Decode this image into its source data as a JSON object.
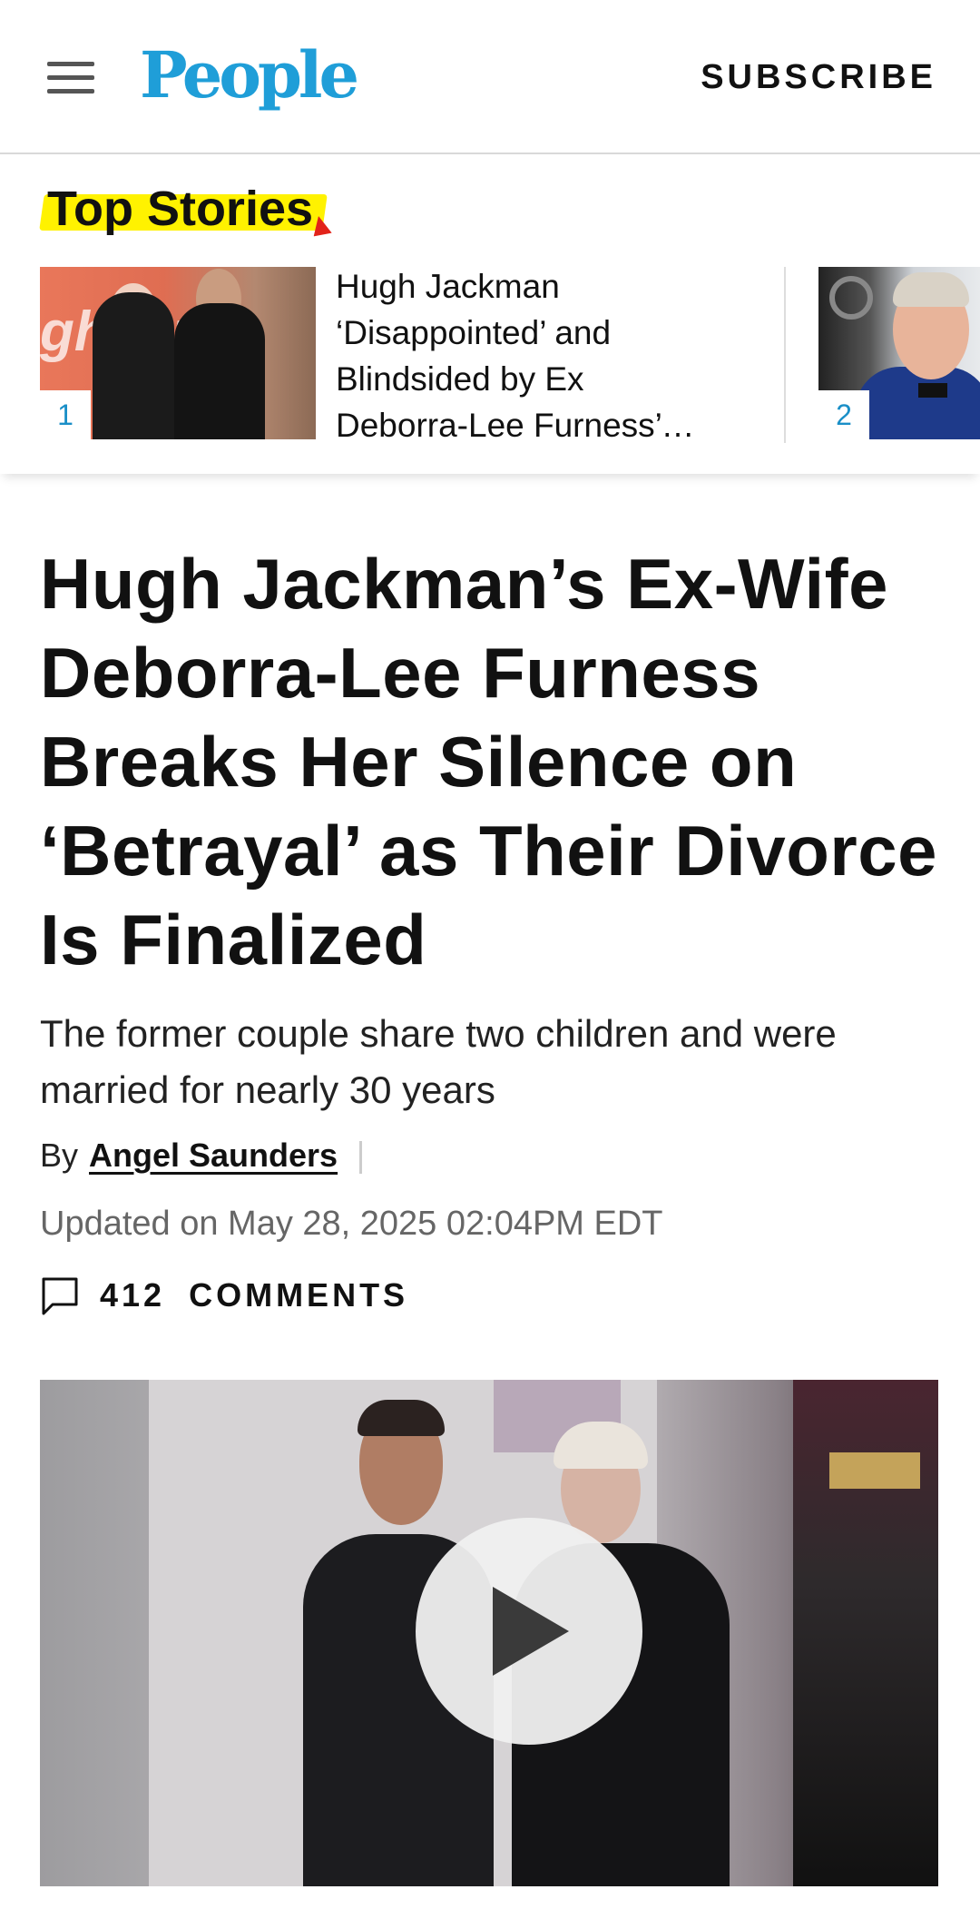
{
  "header": {
    "logo": "People",
    "subscribe_label": "SUBSCRIBE"
  },
  "top_stories": {
    "title": "Top Stories",
    "items": [
      {
        "rank": "1",
        "title": "Hugh Jackman ‘Disappointed’ and Blindsided by Ex Deborra-Lee Furness’ Comments",
        "thumb_text": "ghoste"
      },
      {
        "rank": "2",
        "title": ""
      }
    ]
  },
  "article": {
    "headline": "Hugh Jackman’s Ex-Wife Deborra-Lee Furness Breaks Her Silence on ‘Betrayal’ as Their Divorce Is Finalized",
    "dek": "The former couple share two children and were married for nearly 30 years",
    "byline_prefix": "By",
    "author": "Angel Saunders",
    "updated": "Updated on May 28, 2025 02:04PM EDT",
    "comments_count": "412",
    "comments_label": "COMMENTS"
  },
  "colors": {
    "brand": "#1f9ed8",
    "highlight": "#fff200",
    "rank_number": "#1a8fc7"
  },
  "icons": [
    "hamburger-menu-icon",
    "comment-bubble-icon",
    "play-icon"
  ]
}
